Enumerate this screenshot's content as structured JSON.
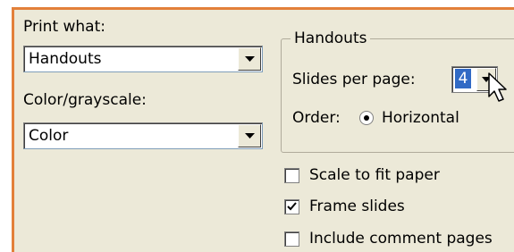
{
  "print_what": {
    "label": "Print what:",
    "value": "Handouts"
  },
  "color_grayscale": {
    "label": "Color/grayscale:",
    "value": "Color"
  },
  "handouts": {
    "title": "Handouts",
    "slides_per_page_label": "Slides per page:",
    "slides_per_page_value": "4",
    "order_label": "Order:",
    "order_horizontal": "Horizontal",
    "order_selected": "Horizontal"
  },
  "options": [
    {
      "label": "Scale to fit paper",
      "checked": false
    },
    {
      "label": "Frame slides",
      "checked": true
    },
    {
      "label": "Include comment pages",
      "checked": false
    }
  ],
  "colors": {
    "dialog_bg": "#ece9d8",
    "accent_border": "#e3803a",
    "selection": "#316ac5"
  }
}
